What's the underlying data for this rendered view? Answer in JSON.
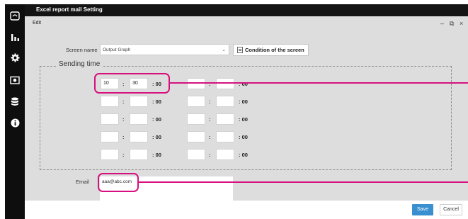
{
  "window": {
    "title": "Excel report mail Setting",
    "menu_edit": "Edit",
    "controls": {
      "minimize": "–",
      "maximize": "⧉",
      "close": "×"
    }
  },
  "sidebar": {
    "icons": [
      "monitor-icon",
      "bar-chart-icon",
      "gear-icon",
      "camera-icon",
      "database-icon",
      "info-icon"
    ]
  },
  "form": {
    "screen_name_label": "Screen name",
    "screen_name_value": "Output Graph",
    "screen_name_chevron": "⌄",
    "condition_button_label": "Condition of the screen",
    "sending_time_legend": "Sending time",
    "time_separator": ":",
    "time_suffix": ": 00",
    "times": [
      [
        "10",
        "30"
      ],
      [
        "",
        ""
      ],
      [
        "",
        ""
      ],
      [
        "",
        ""
      ],
      [
        "",
        ""
      ],
      [
        "",
        ""
      ],
      [
        "",
        ""
      ],
      [
        "",
        ""
      ],
      [
        "",
        ""
      ],
      [
        "",
        ""
      ]
    ],
    "email_label": "Email",
    "email_value": "aaa@abc.com"
  },
  "footer": {
    "save_label": "Save",
    "cancel_label": "Cancel"
  },
  "colors": {
    "highlight": "#d6117f",
    "save_button": "#3a8fd0",
    "titlebar": "#141414",
    "panel": "#dcdddc"
  }
}
